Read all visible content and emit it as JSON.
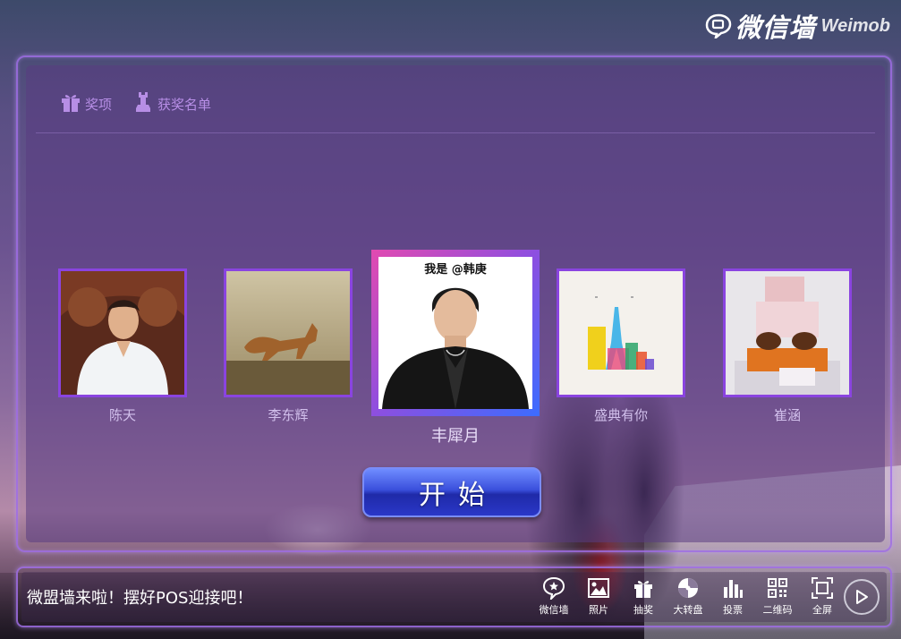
{
  "brand": {
    "cn": "微信墙",
    "en": "Weimob"
  },
  "tabs": [
    {
      "label": "奖项",
      "icon": "gift-icon"
    },
    {
      "label": "获奖名单",
      "icon": "chess-rook-icon"
    }
  ],
  "cards": [
    {
      "name": "陈天"
    },
    {
      "name": "李东辉"
    },
    {
      "name": "丰犀月",
      "photo_text": "我是 @韩庚"
    },
    {
      "name": "盛典有你"
    },
    {
      "name": "崔涵"
    }
  ],
  "start_button": {
    "label": "开始"
  },
  "marquee": {
    "text": "微盟墙来啦！摆好POS迎接吧！"
  },
  "toolbar": [
    {
      "label": "微信墙",
      "icon": "chat-star-icon"
    },
    {
      "label": "照片",
      "icon": "picture-icon"
    },
    {
      "label": "抽奖",
      "icon": "gift-icon"
    },
    {
      "label": "大转盘",
      "icon": "wheel-icon"
    },
    {
      "label": "投票",
      "icon": "bar-chart-icon"
    },
    {
      "label": "二维码",
      "icon": "qr-code-icon"
    },
    {
      "label": "全屏",
      "icon": "fullscreen-icon"
    }
  ],
  "play_button": {
    "icon": "play-icon"
  },
  "colors": {
    "accent_purple": "#8a44e0",
    "tab_text": "#b78ee6",
    "button_blue": "#3a4fdc"
  }
}
